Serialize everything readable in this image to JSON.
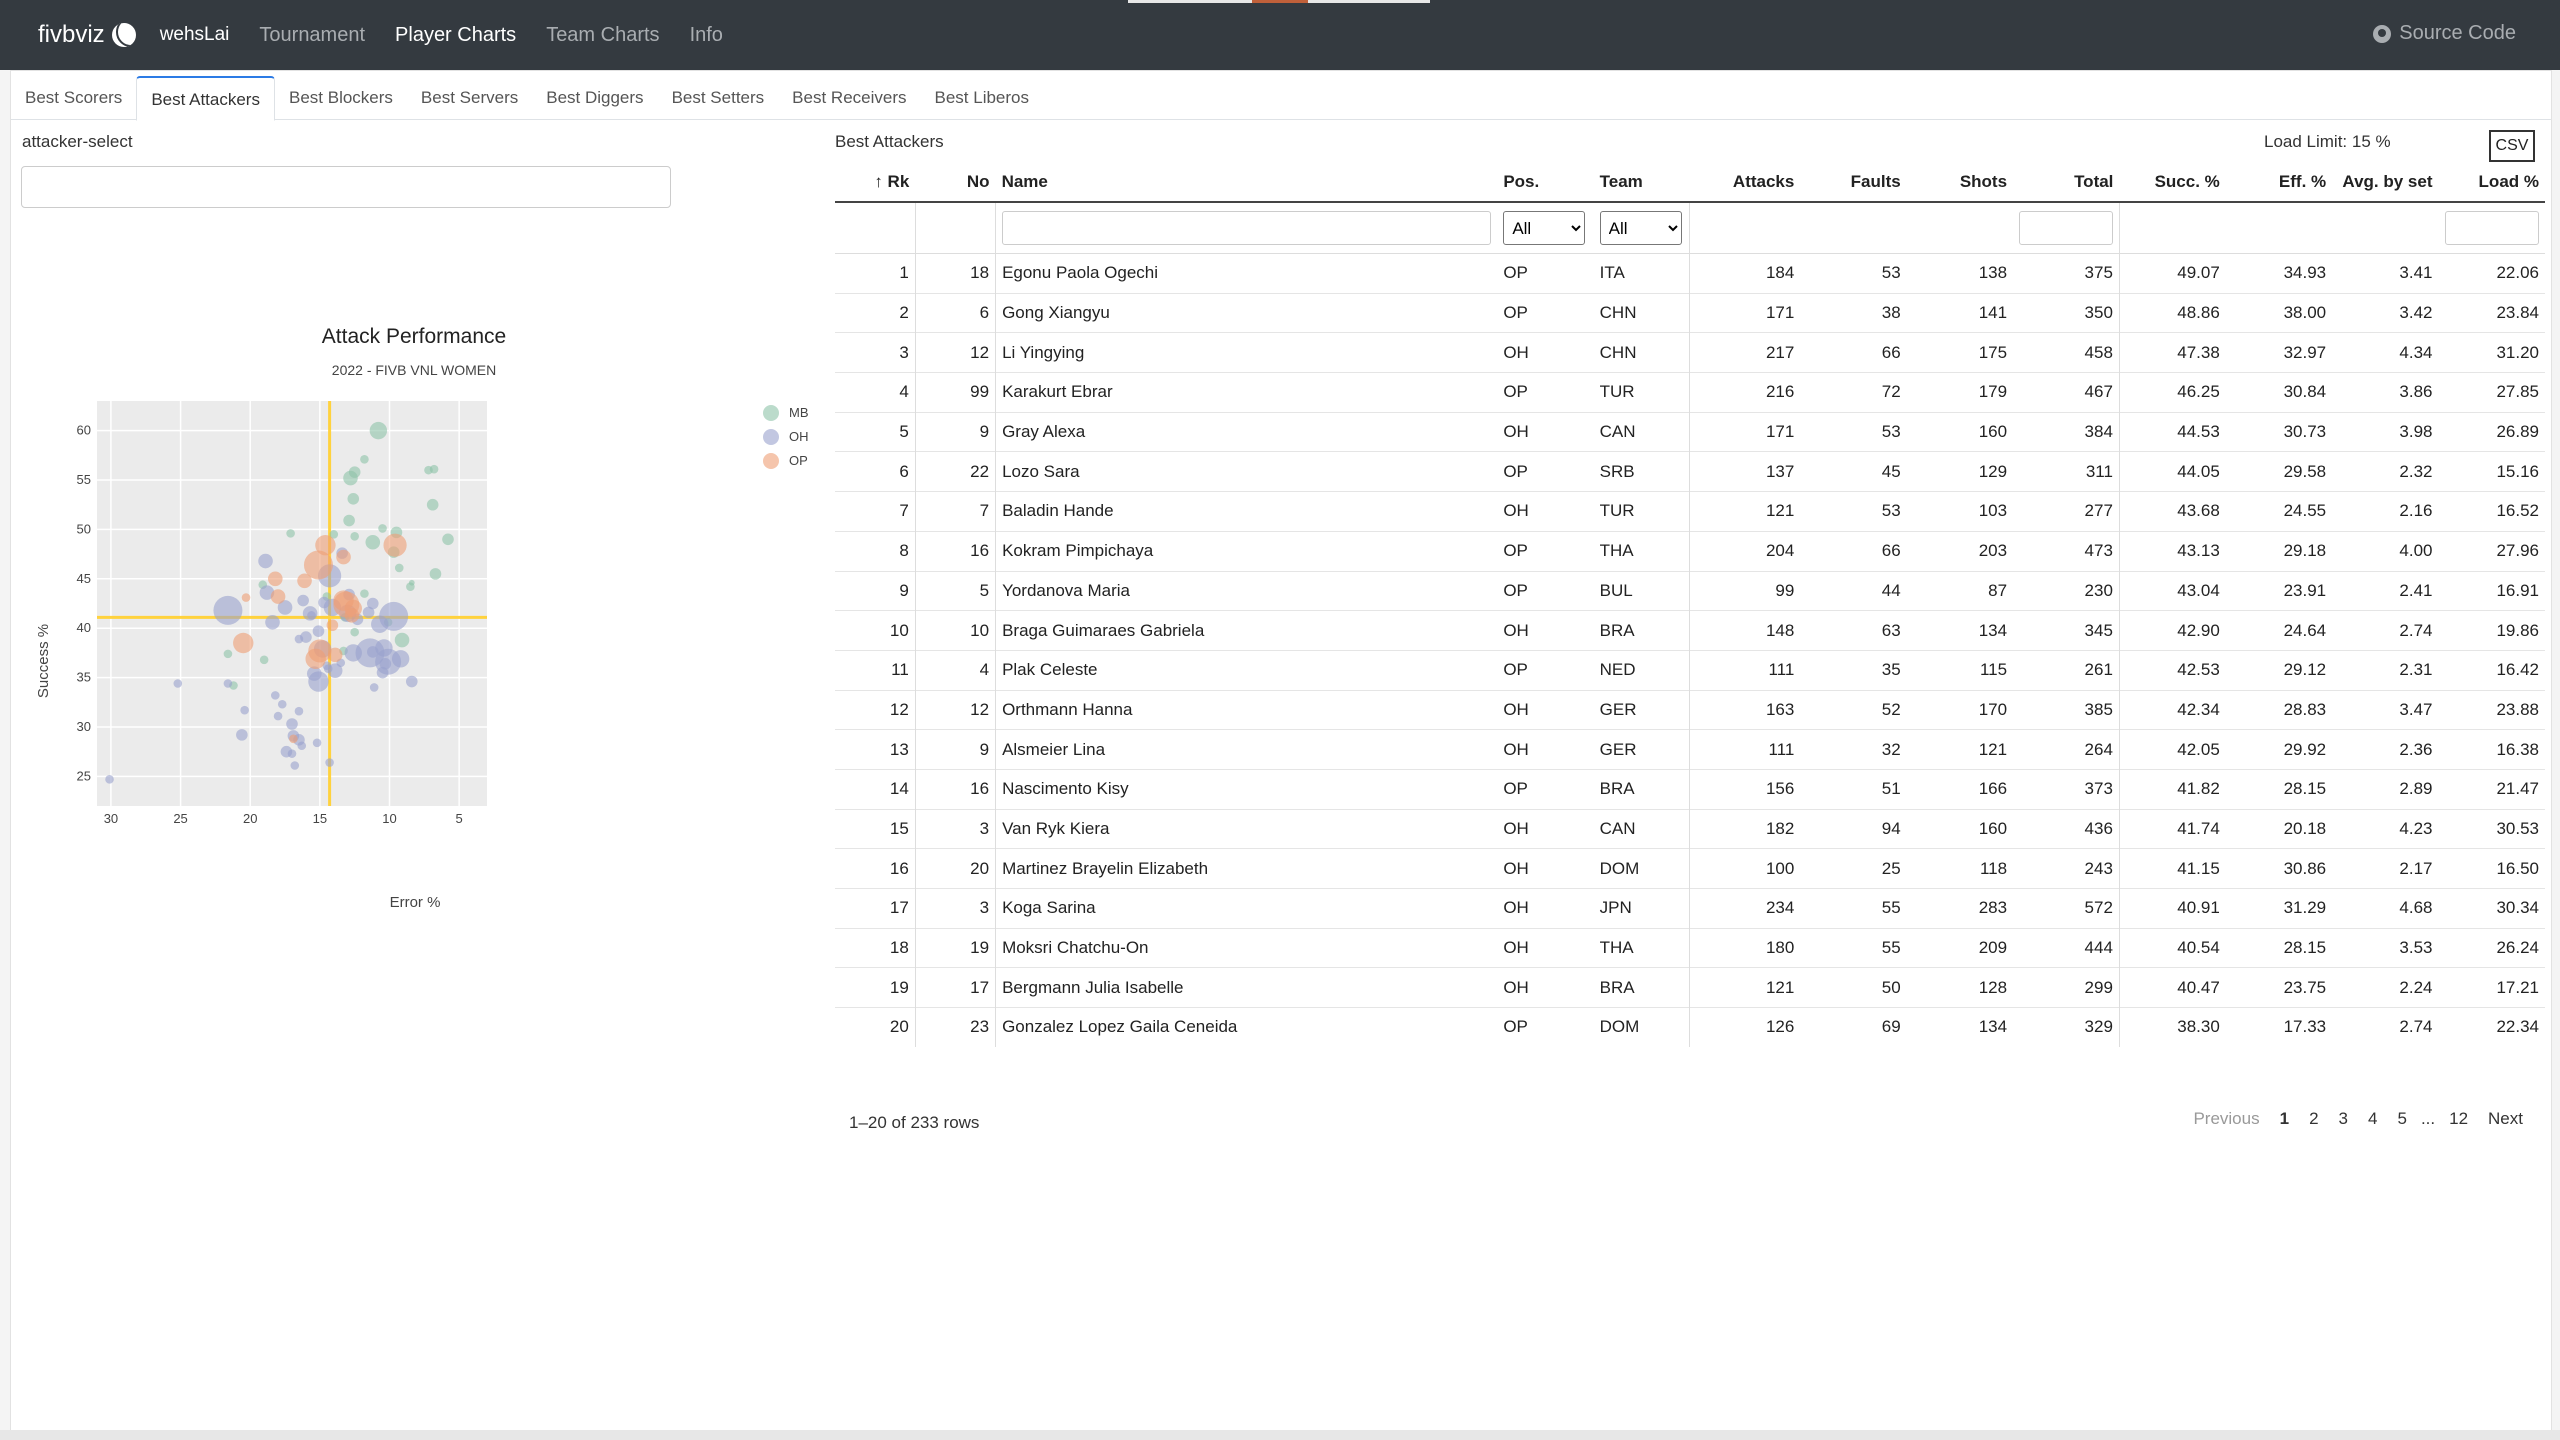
{
  "nav": {
    "brand": "fivbviz",
    "user": "wehsLai",
    "links": [
      "Tournament",
      "Player Charts",
      "Team Charts",
      "Info"
    ],
    "active": "Player Charts",
    "source": "Source Code"
  },
  "tabs": [
    "Best Scorers",
    "Best Attackers",
    "Best Blockers",
    "Best Servers",
    "Best Diggers",
    "Best Setters",
    "Best Receivers",
    "Best Liberos"
  ],
  "active_tab": "Best Attackers",
  "select": {
    "label": "attacker-select",
    "value": ""
  },
  "colors": {
    "MB": "#8dc3a8",
    "OH": "#9aa1cd",
    "OP": "#ef9f74",
    "ref_line": "#ffd23d",
    "plot_bg": "#ebebeb"
  },
  "chart_data": {
    "type": "scatter",
    "title": "Attack Performance",
    "subtitle": "2022 - FIVB VNL WOMEN",
    "xlabel": "Error %",
    "ylabel": "Success %",
    "x_reversed": true,
    "xlim": [
      31,
      3
    ],
    "ylim": [
      22,
      63
    ],
    "xticks": [
      30,
      25,
      20,
      15,
      10,
      5
    ],
    "yticks": [
      25,
      30,
      35,
      40,
      45,
      50,
      55,
      60
    ],
    "ref_lines": {
      "x": 14.3,
      "y": 41.1
    },
    "legend": {
      "position": "top-right",
      "entries": [
        "MB",
        "OH",
        "OP"
      ]
    },
    "series": [
      {
        "name": "MB",
        "points": [
          [
            10.8,
            60,
            6
          ],
          [
            11.8,
            57.1,
            3
          ],
          [
            12.5,
            55.8,
            4
          ],
          [
            12.8,
            55.2,
            5
          ],
          [
            12.6,
            53.1,
            4
          ],
          [
            12.9,
            50.9,
            4
          ],
          [
            12.5,
            49.3,
            3
          ],
          [
            11.2,
            48.7,
            5
          ],
          [
            10.5,
            50.1,
            3
          ],
          [
            9.5,
            49.7,
            4
          ],
          [
            9.7,
            47.7,
            4
          ],
          [
            9.3,
            46.1,
            3
          ],
          [
            7.2,
            56,
            3
          ],
          [
            6.8,
            56.1,
            3
          ],
          [
            6.9,
            52.5,
            4
          ],
          [
            5.8,
            49.0,
            4
          ],
          [
            6.7,
            45.5,
            4
          ],
          [
            8.4,
            44.6,
            2
          ],
          [
            8.5,
            44.2,
            3
          ],
          [
            9.1,
            38.8,
            5
          ],
          [
            10.1,
            40.6,
            3
          ],
          [
            12.5,
            39.6,
            3
          ],
          [
            13.2,
            41.1,
            3
          ],
          [
            14,
            49.5,
            3
          ],
          [
            17.1,
            49.6,
            3
          ],
          [
            19,
            36.8,
            3
          ],
          [
            19.1,
            44.4,
            3
          ],
          [
            21.2,
            34.2,
            3
          ],
          [
            21.6,
            37.4,
            3
          ],
          [
            13.3,
            37.7,
            3
          ],
          [
            14.5,
            43.2,
            3
          ],
          [
            11.8,
            43.5,
            3
          ]
        ]
      },
      {
        "name": "OH",
        "points": [
          [
            30.1,
            24.7,
            3
          ],
          [
            25.2,
            34.4,
            3
          ],
          [
            21.6,
            34.4,
            3
          ],
          [
            20.4,
            31.7,
            3
          ],
          [
            20.6,
            29.2,
            4
          ],
          [
            18.9,
            46.8,
            5
          ],
          [
            18.8,
            43.6,
            5
          ],
          [
            18.4,
            40.6,
            5
          ],
          [
            17.5,
            42.1,
            5
          ],
          [
            16.2,
            42.8,
            4
          ],
          [
            15.7,
            41.5,
            5
          ],
          [
            15.6,
            41.3,
            3
          ],
          [
            21.6,
            41.8,
            10
          ],
          [
            18.2,
            33.2,
            3
          ],
          [
            17.7,
            32.3,
            3
          ],
          [
            18,
            31.1,
            3
          ],
          [
            17,
            30.3,
            4
          ],
          [
            16.5,
            38.9,
            3
          ],
          [
            16,
            39.1,
            4
          ],
          [
            15.1,
            39.7,
            4
          ],
          [
            14.8,
            37.9,
            6
          ],
          [
            14.5,
            36.2,
            3
          ],
          [
            14.4,
            35.9,
            3
          ],
          [
            13.5,
            36.5,
            3
          ],
          [
            15.4,
            35.4,
            5
          ],
          [
            13,
            41.5,
            6
          ],
          [
            14.7,
            42.6,
            4
          ],
          [
            14.3,
            45.3,
            8
          ],
          [
            13.4,
            47.6,
            4
          ],
          [
            12.9,
            43.4,
            4
          ],
          [
            12.3,
            40.9,
            4
          ],
          [
            11.5,
            41.6,
            4
          ],
          [
            11.2,
            42.5,
            4
          ],
          [
            9.7,
            41.2,
            10
          ],
          [
            10.7,
            40.4,
            6
          ],
          [
            11.2,
            37.6,
            4
          ],
          [
            9.2,
            36.9,
            6
          ],
          [
            10.1,
            36.6,
            9
          ],
          [
            10.3,
            36.4,
            4
          ],
          [
            10.5,
            35.5,
            4
          ],
          [
            11.1,
            34.0,
            3
          ],
          [
            8.4,
            34.6,
            4
          ],
          [
            12.6,
            37.5,
            6
          ],
          [
            13.9,
            35.7,
            5
          ],
          [
            15.1,
            34.6,
            7
          ],
          [
            16.5,
            31.6,
            3
          ],
          [
            16.9,
            29.1,
            4
          ],
          [
            16.5,
            28.7,
            4
          ],
          [
            15.2,
            28.4,
            3
          ],
          [
            16.3,
            28.1,
            3
          ],
          [
            17.4,
            27.5,
            4
          ],
          [
            17,
            27.3,
            3
          ],
          [
            14.3,
            26.4,
            3
          ],
          [
            16.8,
            26.1,
            3
          ],
          [
            11.4,
            37.5,
            10
          ],
          [
            10.4,
            38.0,
            6
          ],
          [
            14.1,
            42.1,
            6
          ]
        ]
      },
      {
        "name": "OP",
        "points": [
          [
            20.5,
            38.5,
            7
          ],
          [
            20.3,
            43.1,
            3
          ],
          [
            18.2,
            45.0,
            5
          ],
          [
            18,
            43.2,
            5
          ],
          [
            16.1,
            44.8,
            5
          ],
          [
            15.1,
            46.4,
            10
          ],
          [
            14.6,
            48.4,
            7
          ],
          [
            13.3,
            47.2,
            5
          ],
          [
            9.6,
            48.4,
            8
          ],
          [
            13.1,
            42.4,
            9
          ],
          [
            13.3,
            42.8,
            7
          ],
          [
            12.6,
            42.0,
            6
          ],
          [
            12.7,
            41.3,
            5
          ],
          [
            14.1,
            40.3,
            4
          ],
          [
            15,
            37.7,
            8
          ],
          [
            15.3,
            36.9,
            7
          ],
          [
            13.9,
            37.3,
            5
          ],
          [
            16.9,
            28.8,
            3
          ]
        ]
      }
    ]
  },
  "table": {
    "title": "Best Attackers",
    "load_limit": "Load Limit: 15 %",
    "csv": "CSV",
    "sort_indicator": "↑",
    "columns": [
      "Rk",
      "No",
      "Name",
      "Pos.",
      "Team",
      "Attacks",
      "Faults",
      "Shots",
      "Total",
      "Succ. %",
      "Eff. %",
      "Avg. by set",
      "Load %"
    ],
    "filter_all": "All",
    "rows": [
      [
        "1",
        "18",
        "Egonu Paola Ogechi",
        "OP",
        "ITA",
        "184",
        "53",
        "138",
        "375",
        "49.07",
        "34.93",
        "3.41",
        "22.06"
      ],
      [
        "2",
        "6",
        "Gong Xiangyu",
        "OP",
        "CHN",
        "171",
        "38",
        "141",
        "350",
        "48.86",
        "38.00",
        "3.42",
        "23.84"
      ],
      [
        "3",
        "12",
        "Li Yingying",
        "OH",
        "CHN",
        "217",
        "66",
        "175",
        "458",
        "47.38",
        "32.97",
        "4.34",
        "31.20"
      ],
      [
        "4",
        "99",
        "Karakurt Ebrar",
        "OP",
        "TUR",
        "216",
        "72",
        "179",
        "467",
        "46.25",
        "30.84",
        "3.86",
        "27.85"
      ],
      [
        "5",
        "9",
        "Gray Alexa",
        "OH",
        "CAN",
        "171",
        "53",
        "160",
        "384",
        "44.53",
        "30.73",
        "3.98",
        "26.89"
      ],
      [
        "6",
        "22",
        "Lozo Sara",
        "OP",
        "SRB",
        "137",
        "45",
        "129",
        "311",
        "44.05",
        "29.58",
        "2.32",
        "15.16"
      ],
      [
        "7",
        "7",
        "Baladin Hande",
        "OH",
        "TUR",
        "121",
        "53",
        "103",
        "277",
        "43.68",
        "24.55",
        "2.16",
        "16.52"
      ],
      [
        "8",
        "16",
        "Kokram Pimpichaya",
        "OP",
        "THA",
        "204",
        "66",
        "203",
        "473",
        "43.13",
        "29.18",
        "4.00",
        "27.96"
      ],
      [
        "9",
        "5",
        "Yordanova Maria",
        "OP",
        "BUL",
        "99",
        "44",
        "87",
        "230",
        "43.04",
        "23.91",
        "2.41",
        "16.91"
      ],
      [
        "10",
        "10",
        "Braga Guimaraes Gabriela",
        "OH",
        "BRA",
        "148",
        "63",
        "134",
        "345",
        "42.90",
        "24.64",
        "2.74",
        "19.86"
      ],
      [
        "11",
        "4",
        "Plak Celeste",
        "OP",
        "NED",
        "111",
        "35",
        "115",
        "261",
        "42.53",
        "29.12",
        "2.31",
        "16.42"
      ],
      [
        "12",
        "12",
        "Orthmann Hanna",
        "OH",
        "GER",
        "163",
        "52",
        "170",
        "385",
        "42.34",
        "28.83",
        "3.47",
        "23.88"
      ],
      [
        "13",
        "9",
        "Alsmeier Lina",
        "OH",
        "GER",
        "111",
        "32",
        "121",
        "264",
        "42.05",
        "29.92",
        "2.36",
        "16.38"
      ],
      [
        "14",
        "16",
        "Nascimento Kisy",
        "OP",
        "BRA",
        "156",
        "51",
        "166",
        "373",
        "41.82",
        "28.15",
        "2.89",
        "21.47"
      ],
      [
        "15",
        "3",
        "Van Ryk Kiera",
        "OH",
        "CAN",
        "182",
        "94",
        "160",
        "436",
        "41.74",
        "20.18",
        "4.23",
        "30.53"
      ],
      [
        "16",
        "20",
        "Martinez Brayelin Elizabeth",
        "OH",
        "DOM",
        "100",
        "25",
        "118",
        "243",
        "41.15",
        "30.86",
        "2.17",
        "16.50"
      ],
      [
        "17",
        "3",
        "Koga Sarina",
        "OH",
        "JPN",
        "234",
        "55",
        "283",
        "572",
        "40.91",
        "31.29",
        "4.68",
        "30.34"
      ],
      [
        "18",
        "19",
        "Moksri Chatchu-On",
        "OH",
        "THA",
        "180",
        "55",
        "209",
        "444",
        "40.54",
        "28.15",
        "3.53",
        "26.24"
      ],
      [
        "19",
        "17",
        "Bergmann Julia Isabelle",
        "OH",
        "BRA",
        "121",
        "50",
        "128",
        "299",
        "40.47",
        "23.75",
        "2.24",
        "17.21"
      ],
      [
        "20",
        "23",
        "Gonzalez Lopez Gaila Ceneida",
        "OP",
        "DOM",
        "126",
        "69",
        "134",
        "329",
        "38.30",
        "17.33",
        "2.74",
        "22.34"
      ]
    ],
    "row_info": "1–20 of 233 rows",
    "pager": {
      "previous": "Previous",
      "pages": [
        "1",
        "2",
        "3",
        "4",
        "5"
      ],
      "ellipsis": "...",
      "last": "12",
      "next": "Next",
      "current": "1"
    }
  }
}
